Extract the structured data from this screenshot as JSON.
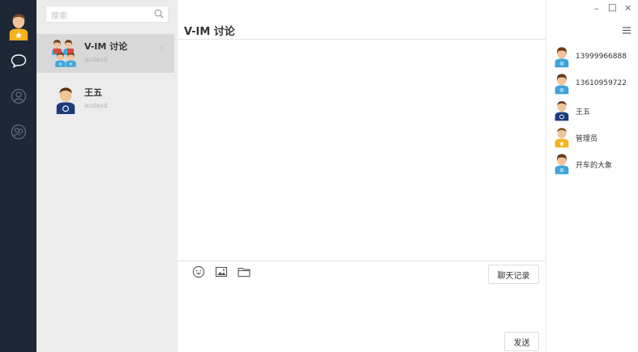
{
  "window": {
    "minimize": "–",
    "maximize": "☐",
    "close": "×"
  },
  "search": {
    "placeholder": "搜索"
  },
  "sessions": [
    {
      "name": "V-IM 讨论",
      "preview": "asdasd",
      "close": "×",
      "avatar": "group-avatar"
    },
    {
      "name": "王五",
      "preview": "asdasd",
      "avatar": "user-avatar-wordpress"
    }
  ],
  "chat": {
    "title": "V-IM 讨论",
    "history_label": "聊天记录",
    "send_label": "发送"
  },
  "members": [
    {
      "name": "13999966888",
      "avatar": "user-avatar-blue"
    },
    {
      "name": "13610959722",
      "avatar": "user-avatar-blue"
    },
    {
      "name": "王五",
      "avatar": "user-avatar-wordpress"
    },
    {
      "name": "管理员",
      "avatar": "user-avatar-yellow-star"
    },
    {
      "name": "开车的大象",
      "avatar": "user-avatar-blue"
    }
  ],
  "colors": {
    "rail": "#1e2736",
    "session_bg": "#ececec",
    "active_session": "#d8d8d8",
    "border": "#e3e3e3"
  }
}
